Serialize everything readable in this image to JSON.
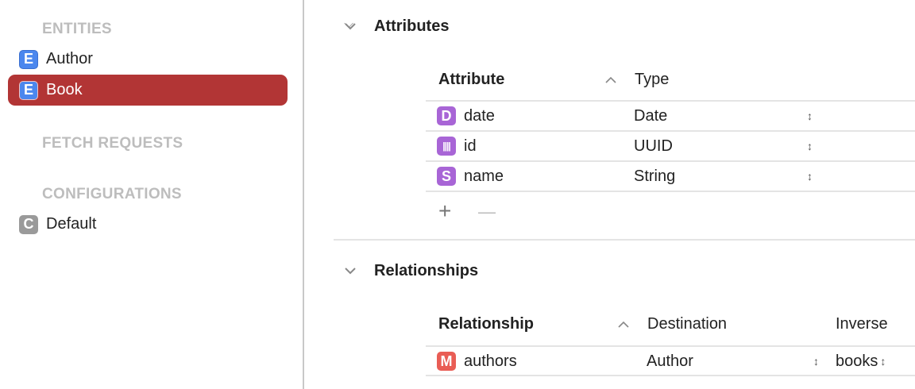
{
  "sidebar": {
    "entities_header": "ENTITIES",
    "entities": [
      {
        "badge": "E",
        "label": "Author",
        "selected": false
      },
      {
        "badge": "E",
        "label": "Book",
        "selected": true
      }
    ],
    "fetch_header": "FETCH REQUESTS",
    "config_header": "CONFIGURATIONS",
    "configurations": [
      {
        "badge": "C",
        "label": "Default"
      }
    ]
  },
  "attributes": {
    "title": "Attributes",
    "col_attribute": "Attribute",
    "col_type": "Type",
    "rows": [
      {
        "badge": "D",
        "name": "date",
        "type": "Date"
      },
      {
        "badge": "||||",
        "name": "id",
        "type": "UUID"
      },
      {
        "badge": "S",
        "name": "name",
        "type": "String"
      }
    ],
    "add": "+",
    "remove": "—"
  },
  "relationships": {
    "title": "Relationships",
    "col_relationship": "Relationship",
    "col_destination": "Destination",
    "col_inverse": "Inverse",
    "rows": [
      {
        "badge": "M",
        "name": "authors",
        "destination": "Author",
        "inverse": "books"
      }
    ]
  },
  "colors": {
    "selection": "#b23535",
    "entity_badge": "#4b87ee",
    "attribute_badge": "#a865d6",
    "relationship_badge": "#e95d55"
  }
}
